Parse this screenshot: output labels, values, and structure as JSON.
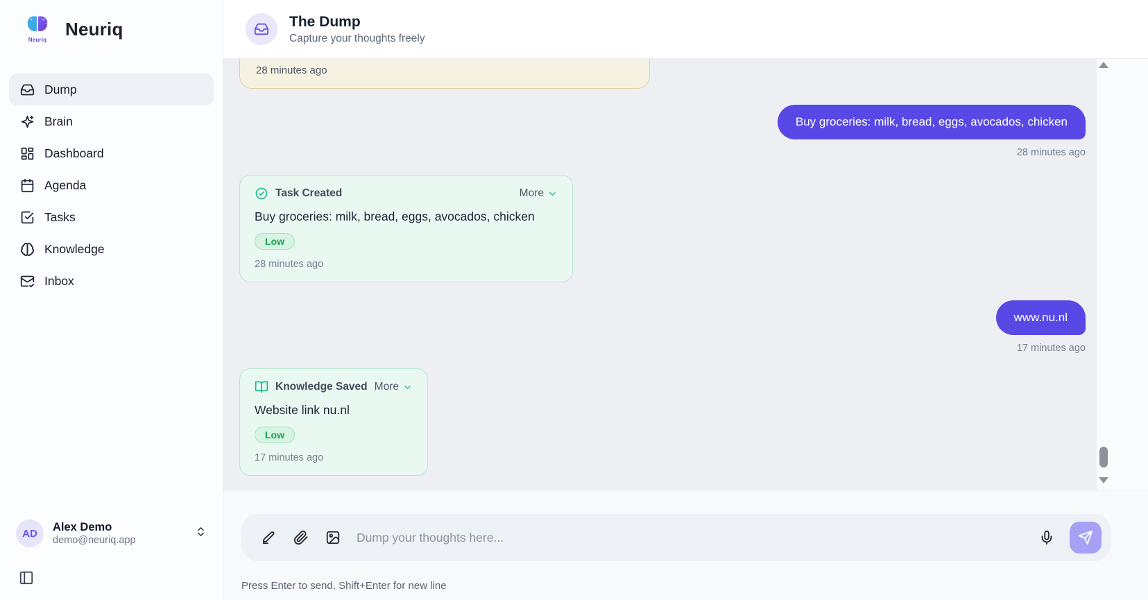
{
  "app": {
    "brand": "Neuriq"
  },
  "sidebar": {
    "items": [
      {
        "label": "Dump",
        "icon": "inbox-tray-icon",
        "active": true
      },
      {
        "label": "Brain",
        "icon": "sparkles-icon",
        "active": false
      },
      {
        "label": "Dashboard",
        "icon": "dashboard-grid-icon",
        "active": false
      },
      {
        "label": "Agenda",
        "icon": "calendar-icon",
        "active": false
      },
      {
        "label": "Tasks",
        "icon": "check-square-icon",
        "active": false
      },
      {
        "label": "Knowledge",
        "icon": "brain-icon",
        "active": false
      },
      {
        "label": "Inbox",
        "icon": "mail-check-icon",
        "active": false
      }
    ],
    "profile": {
      "initials": "AD",
      "name": "Alex Demo",
      "email": "demo@neuriq.app"
    }
  },
  "header": {
    "title": "The Dump",
    "subtitle": "Capture your thoughts freely",
    "icon": "inbox-tray-icon"
  },
  "chat": {
    "partial_card": {
      "timestamp": "28 minutes ago"
    },
    "messages": [
      {
        "type": "user",
        "text": "Buy groceries: milk, bread, eggs, avocados, chicken",
        "timestamp": "28 minutes ago"
      },
      {
        "type": "system-card",
        "title": "Task Created",
        "icon": "check-circle-icon",
        "more_label": "More",
        "text": "Buy groceries: milk, bread, eggs, avocados, chicken",
        "priority": "Low",
        "timestamp": "28 minutes ago"
      },
      {
        "type": "user",
        "text": "www.nu.nl",
        "timestamp": "17 minutes ago"
      },
      {
        "type": "system-card",
        "title": "Knowledge Saved",
        "icon": "book-open-icon",
        "more_label": "More",
        "text": "Website link nu.nl",
        "priority": "Low",
        "timestamp": "17 minutes ago"
      }
    ]
  },
  "composer": {
    "placeholder": "Dump your thoughts here...",
    "hint": "Press Enter to send, Shift+Enter for new line"
  },
  "colors": {
    "accent_purple": "#5848e5",
    "send_button": "#a6a1f4",
    "mint_bg": "#e9f8f1",
    "mint_border": "#b7e6d1",
    "teal_icon": "#14c08f",
    "badge_text": "#1da156",
    "amber_bg": "#f6f2e2",
    "amber_border": "#e2cfa1",
    "chat_bg": "#edeff3"
  }
}
